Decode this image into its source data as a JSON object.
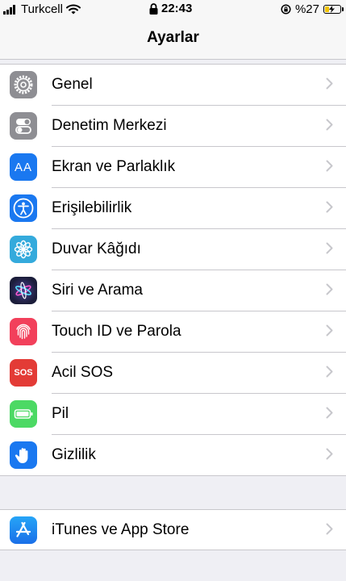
{
  "status_bar": {
    "carrier": "Turkcell",
    "time": "22:43",
    "battery_text": "%27",
    "battery_level": 0.27,
    "battery_color": "#f2c200"
  },
  "nav": {
    "title": "Ayarlar"
  },
  "settings_group_1": [
    {
      "label": "Genel",
      "icon": "gear-icon",
      "color": "#8e8e93"
    },
    {
      "label": "Denetim Merkezi",
      "icon": "toggle-switches-icon",
      "color": "#8e8e93"
    },
    {
      "label": "Ekran ve Parlaklık",
      "icon": "text-size-icon",
      "color": "#1a78f0",
      "icon_text": "AA"
    },
    {
      "label": "Erişilebilirlik",
      "icon": "accessibility-icon",
      "color": "#1a78f0"
    },
    {
      "label": "Duvar Kâğıdı",
      "icon": "flower-icon",
      "color": "#34aadc"
    },
    {
      "label": "Siri ve Arama",
      "icon": "siri-icon",
      "color": "#1b1d3a"
    },
    {
      "label": "Touch ID ve Parola",
      "icon": "fingerprint-icon",
      "color": "#f2405b"
    },
    {
      "label": "Acil SOS",
      "icon": "sos-icon",
      "color": "#e33b36",
      "icon_text": "SOS"
    },
    {
      "label": "Pil",
      "icon": "battery-icon",
      "color": "#4cd964"
    },
    {
      "label": "Gizlilik",
      "icon": "hand-icon",
      "color": "#1a78f0"
    }
  ],
  "settings_group_2": [
    {
      "label": "iTunes ve App Store",
      "icon": "app-store-icon",
      "color": "#1e8cf2"
    }
  ]
}
